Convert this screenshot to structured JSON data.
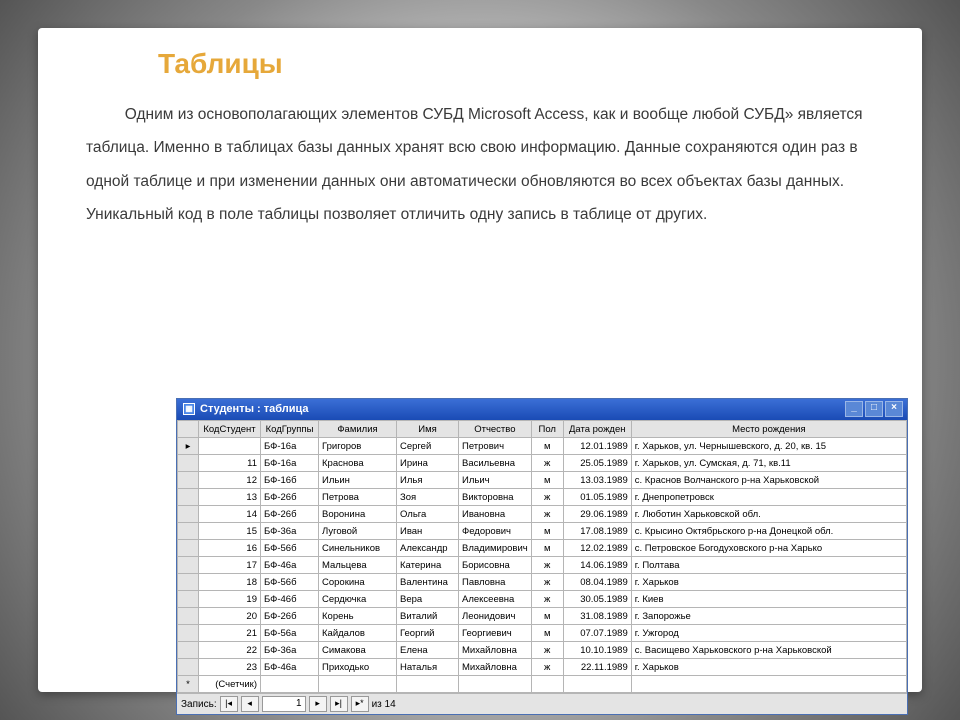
{
  "title": "Таблицы",
  "body_text": "Одним из основополагающих элементов СУБД Microsoft Access, как и вообще любой СУБД» является таблица. Именно в таблицах базы данных хранят всю свою информацию. Данные сохраняются один раз в одной таблице и при изменении данных они автоматически обновляются во всех объектах базы данных. Уникальный код в поле таблицы позволяет отличить одну запись в таблице от других.",
  "access": {
    "window_title": "Студенты : таблица",
    "columns": [
      "КодСтудент",
      "КодГруппы",
      "Фамилия",
      "Имя",
      "Отчество",
      "Пол",
      "Дата рожден",
      "Место рождения"
    ],
    "rows": [
      {
        "sel": "▸",
        "id": "",
        "grp": "БФ-16а",
        "fam": "Григоров",
        "name": "Сергей",
        "otch": "Петрович",
        "pol": "м",
        "dob": "12.01.1989",
        "place": "г. Харьков, ул. Чернышевского, д. 20, кв. 15"
      },
      {
        "sel": "",
        "id": "11",
        "grp": "БФ-16а",
        "fam": "Краснова",
        "name": "Ирина",
        "otch": "Васильевна",
        "pol": "ж",
        "dob": "25.05.1989",
        "place": "г. Харьков, ул. Сумская, д. 71, кв.11"
      },
      {
        "sel": "",
        "id": "12",
        "grp": "БФ-16б",
        "fam": "Ильин",
        "name": "Илья",
        "otch": "Ильич",
        "pol": "м",
        "dob": "13.03.1989",
        "place": "с. Краснов  Волчанского р-на  Харьковской"
      },
      {
        "sel": "",
        "id": "13",
        "grp": "БФ-26б",
        "fam": "Петрова",
        "name": "Зоя",
        "otch": "Викторовна",
        "pol": "ж",
        "dob": "01.05.1989",
        "place": "г. Днепропетровск"
      },
      {
        "sel": "",
        "id": "14",
        "grp": "БФ-26б",
        "fam": "Воронина",
        "name": "Ольга",
        "otch": "Ивановна",
        "pol": "ж",
        "dob": "29.06.1989",
        "place": "г. Люботин Харьковской обл."
      },
      {
        "sel": "",
        "id": "15",
        "grp": "БФ-36а",
        "fam": "Луговой",
        "name": "Иван",
        "otch": "Федорович",
        "pol": "м",
        "dob": "17.08.1989",
        "place": "с. Крысино Октябрьского р-на Донецкой обл."
      },
      {
        "sel": "",
        "id": "16",
        "grp": "БФ-56б",
        "fam": "Синельников",
        "name": "Александр",
        "otch": "Владимирович",
        "pol": "м",
        "dob": "12.02.1989",
        "place": "с. Петровское Богодуховского р-на Харько"
      },
      {
        "sel": "",
        "id": "17",
        "grp": "БФ-46а",
        "fam": "Мальцева",
        "name": "Катерина",
        "otch": "Борисовна",
        "pol": "ж",
        "dob": "14.06.1989",
        "place": "г. Полтава"
      },
      {
        "sel": "",
        "id": "18",
        "grp": "БФ-56б",
        "fam": "Сорокина",
        "name": "Валентина",
        "otch": "Павловна",
        "pol": "ж",
        "dob": "08.04.1989",
        "place": "г. Харьков"
      },
      {
        "sel": "",
        "id": "19",
        "grp": "БФ-46б",
        "fam": "Сердючка",
        "name": "Вера",
        "otch": "Алексеевна",
        "pol": "ж",
        "dob": "30.05.1989",
        "place": "г. Киев"
      },
      {
        "sel": "",
        "id": "20",
        "grp": "БФ-26б",
        "fam": "Корень",
        "name": "Виталий",
        "otch": "Леонидович",
        "pol": "м",
        "dob": "31.08.1989",
        "place": "г. Запорожье"
      },
      {
        "sel": "",
        "id": "21",
        "grp": "БФ-56а",
        "fam": "Кайдалов",
        "name": "Георгий",
        "otch": "Георгиевич",
        "pol": "м",
        "dob": "07.07.1989",
        "place": "г. Ужгород"
      },
      {
        "sel": "",
        "id": "22",
        "grp": "БФ-36а",
        "fam": "Симакова",
        "name": "Елена",
        "otch": "Михайловна",
        "pol": "ж",
        "dob": "10.10.1989",
        "place": "с. Васищево Харьковского р-на Харьковской"
      },
      {
        "sel": "",
        "id": "23",
        "grp": "БФ-46а",
        "fam": "Приходько",
        "name": "Наталья",
        "otch": "Михайловна",
        "pol": "ж",
        "dob": "22.11.1989",
        "place": "г. Харьков"
      }
    ],
    "new_row_label": "(Счетчик)",
    "nav": {
      "label": "Запись:",
      "current": "1",
      "total": "из  14"
    }
  }
}
